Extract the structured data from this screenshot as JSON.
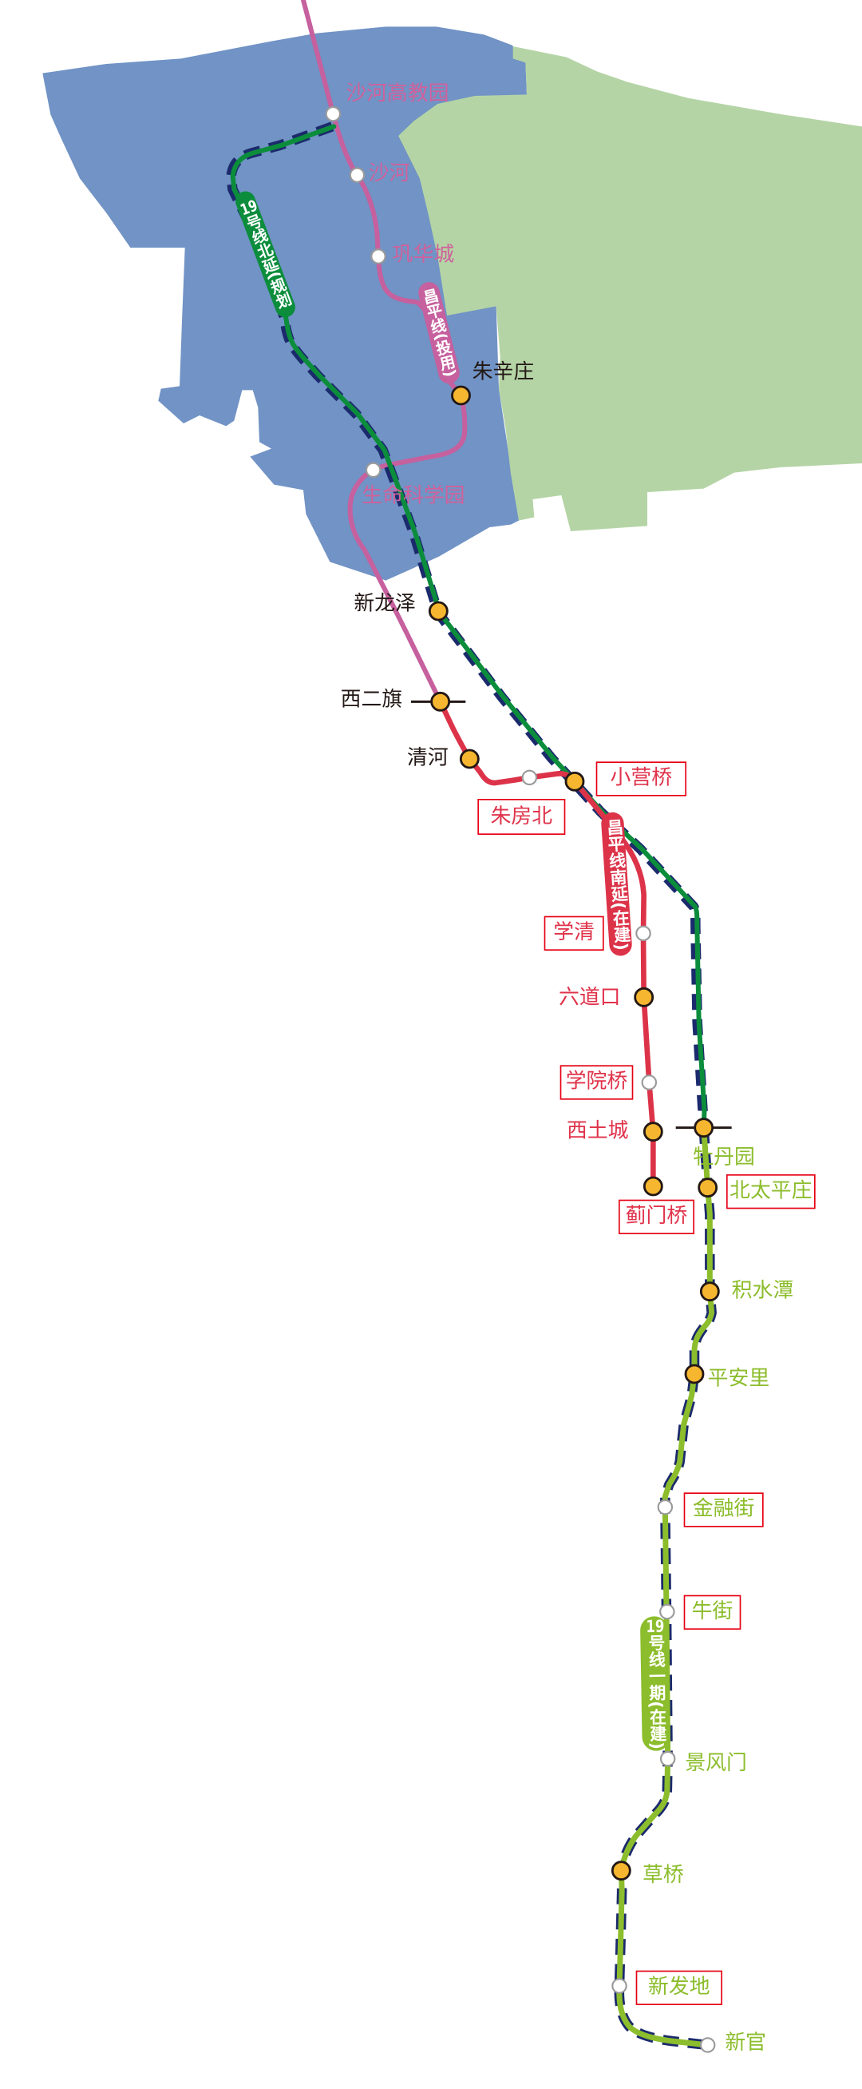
{
  "areas": {
    "blue_district": {
      "color": "#7193c5"
    },
    "green_district": {
      "color": "#b5d4a6"
    }
  },
  "lines": {
    "changping_operating": {
      "label": "昌平线(投用)",
      "color": "#c6609e"
    },
    "changping_south_extension": {
      "label": "昌平线南延(在建)",
      "color": "#dc3349"
    },
    "line19_north_extension": {
      "label_number": "19",
      "label_text": "号线北延(规划",
      "color": "#0b8d3c"
    },
    "line19_phase1": {
      "label_number": "19",
      "label_text": "号线一期(在建)",
      "color": "#8cbd2c"
    },
    "line19_dash_color": "#1b2a6c",
    "transfer_tick_color": "#231815",
    "pill_text_color": "#ffffff"
  },
  "markers": {
    "transfer_fill": "#f6b62f",
    "transfer_stroke": "#231815",
    "regular_fill": "#ffffff",
    "regular_stroke": "#9a9a9a"
  },
  "label_colors": {
    "changping_operating": "#d0619c",
    "existing": "#231815",
    "changping_south_extension": "#e0334b",
    "line19_phase1": "#8cbd2c",
    "highlight_box": "#e60012"
  },
  "stations": [
    {
      "name": "沙河高教园",
      "line": "changping_operating",
      "marker": "regular",
      "highlighted": false
    },
    {
      "name": "沙河",
      "line": "changping_operating",
      "marker": "regular",
      "highlighted": false
    },
    {
      "name": "巩华城",
      "line": "changping_operating",
      "marker": "regular",
      "highlighted": false
    },
    {
      "name": "朱辛庄",
      "line": "changping_operating",
      "marker": "transfer",
      "highlighted": false
    },
    {
      "name": "生命科学园",
      "line": "changping_operating",
      "marker": "regular",
      "highlighted": false
    },
    {
      "name": "新龙泽",
      "line": "line19_north_extension",
      "marker": "transfer",
      "highlighted": false
    },
    {
      "name": "西二旗",
      "line": "changping_operating",
      "marker": "transfer",
      "highlighted": false
    },
    {
      "name": "清河",
      "line": "changping_south_extension",
      "marker": "transfer",
      "highlighted": false
    },
    {
      "name": "朱房北",
      "line": "changping_south_extension",
      "marker": "regular",
      "highlighted": true
    },
    {
      "name": "小营桥",
      "line": "changping_south_extension",
      "marker": "transfer",
      "highlighted": true
    },
    {
      "name": "学清",
      "line": "changping_south_extension",
      "marker": "regular",
      "highlighted": true
    },
    {
      "name": "六道口",
      "line": "changping_south_extension",
      "marker": "transfer",
      "highlighted": false
    },
    {
      "name": "学院桥",
      "line": "changping_south_extension",
      "marker": "regular",
      "highlighted": true
    },
    {
      "name": "西土城",
      "line": "changping_south_extension",
      "marker": "transfer",
      "highlighted": false
    },
    {
      "name": "蓟门桥",
      "line": "changping_south_extension",
      "marker": "transfer",
      "highlighted": true
    },
    {
      "name": "牡丹园",
      "line": "line19_phase1",
      "marker": "transfer",
      "highlighted": false
    },
    {
      "name": "北太平庄",
      "line": "line19_phase1",
      "marker": "transfer",
      "highlighted": true
    },
    {
      "name": "积水潭",
      "line": "line19_phase1",
      "marker": "transfer",
      "highlighted": false
    },
    {
      "name": "平安里",
      "line": "line19_phase1",
      "marker": "transfer",
      "highlighted": false
    },
    {
      "name": "金融街",
      "line": "line19_phase1",
      "marker": "regular",
      "highlighted": true
    },
    {
      "name": "牛街",
      "line": "line19_phase1",
      "marker": "regular",
      "highlighted": true
    },
    {
      "name": "景风门",
      "line": "line19_phase1",
      "marker": "regular",
      "highlighted": false
    },
    {
      "name": "草桥",
      "line": "line19_phase1",
      "marker": "transfer",
      "highlighted": false
    },
    {
      "name": "新发地",
      "line": "line19_phase1",
      "marker": "regular",
      "highlighted": true
    },
    {
      "name": "新官",
      "line": "line19_phase1",
      "marker": "regular",
      "highlighted": false
    }
  ]
}
